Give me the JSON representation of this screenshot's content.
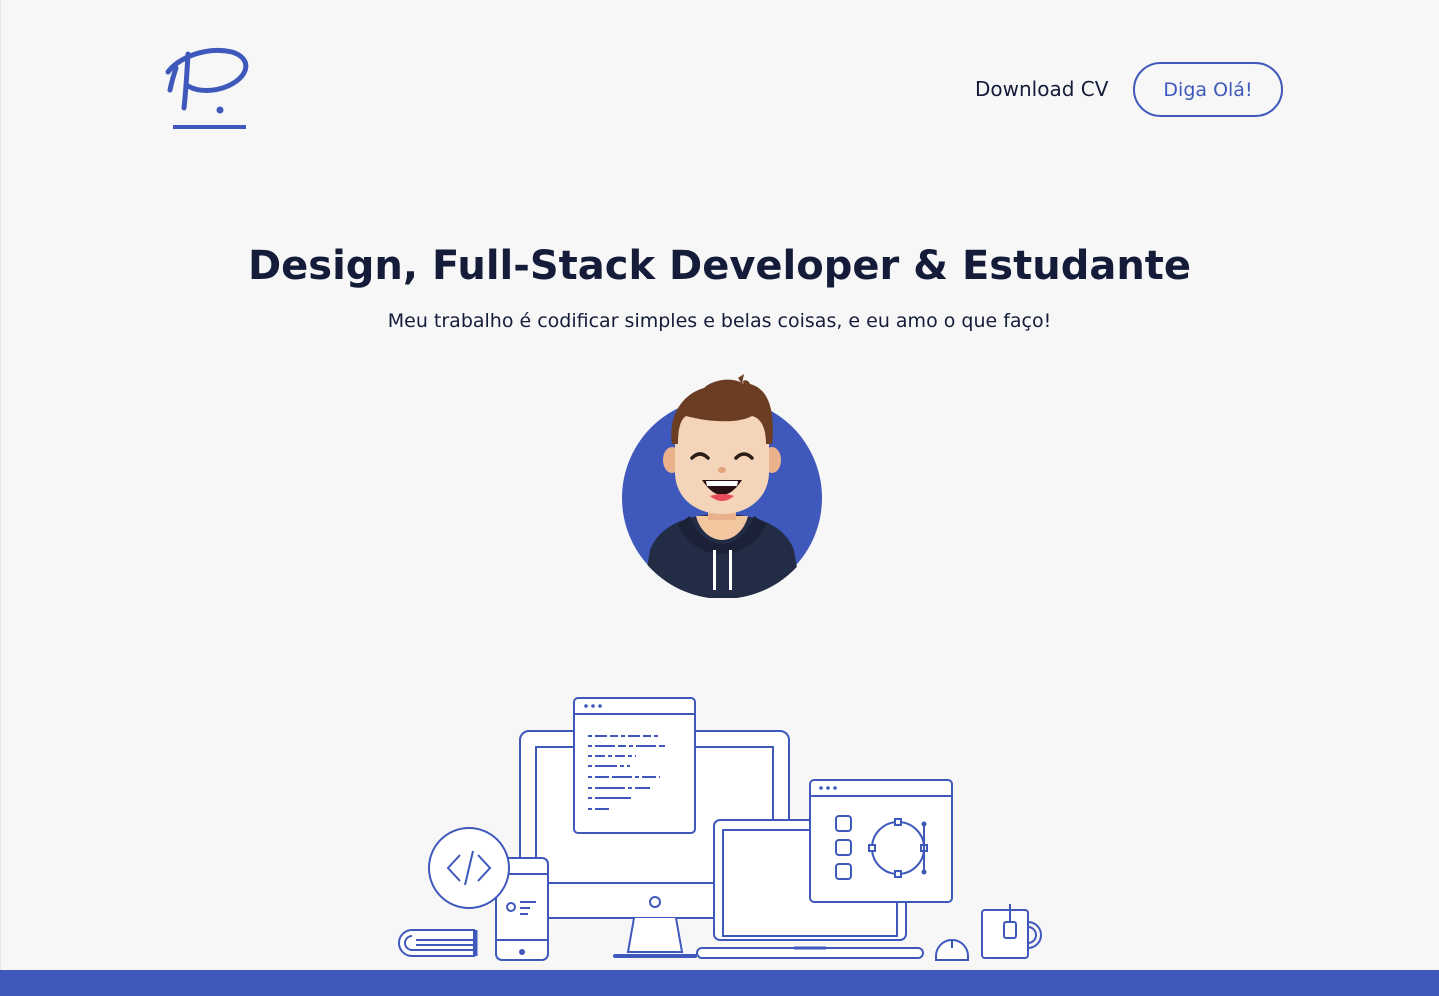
{
  "header": {
    "logo_icon": "signature-p-logo",
    "nav": {
      "download_label": "Download CV",
      "hello_label": "Diga Olá!"
    }
  },
  "hero": {
    "title": "Design, Full-Stack Developer & Estudante",
    "subtitle": "Meu trabalho é codificar simples e belas coisas, e eu amo o que faço!",
    "avatar_icon": "developer-avatar"
  },
  "illustration": {
    "icon": "devices-illustration"
  },
  "colors": {
    "accent": "#3f58bb",
    "text": "#141c3a",
    "background": "#f7f7f7",
    "footer": "#3f58bb"
  }
}
